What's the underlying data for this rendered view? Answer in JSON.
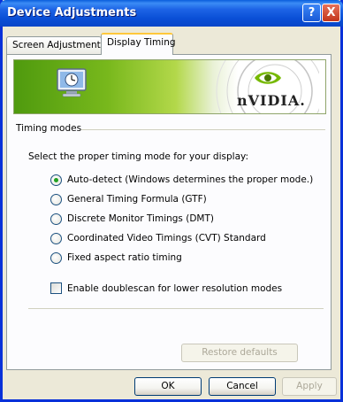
{
  "window": {
    "title": "Device Adjustments",
    "help_icon": "?",
    "close_icon": "X"
  },
  "tabs": [
    {
      "label": "Screen Adjustment",
      "active": false
    },
    {
      "label": "Display Timing",
      "active": true
    }
  ],
  "banner": {
    "logo_text": "nVIDIA.",
    "icons": [
      "monitor-clock-icon",
      "nvidia-eye-logo"
    ],
    "colors": {
      "green": "#78b81c",
      "white": "#ffffff"
    }
  },
  "timing": {
    "group_label": "Timing modes",
    "prompt": "Select the proper timing mode for your display:",
    "options": [
      {
        "label": "Auto-detect (Windows determines the proper mode.)",
        "selected": true
      },
      {
        "label": "General Timing Formula (GTF)",
        "selected": false
      },
      {
        "label": "Discrete Monitor Timings (DMT)",
        "selected": false
      },
      {
        "label": "Coordinated Video Timings (CVT) Standard",
        "selected": false
      },
      {
        "label": "Fixed aspect ratio timing",
        "selected": false
      }
    ],
    "doublescan_label": "Enable doublescan for lower resolution modes",
    "doublescan_checked": false
  },
  "buttons": {
    "restore": "Restore defaults",
    "ok": "OK",
    "cancel": "Cancel",
    "apply": "Apply"
  },
  "colors": {
    "titlebar": "#0a4fd6",
    "dialog_bg": "#ece9d8",
    "panel_bg": "#fcfcfe",
    "radio_selected": "#21a121"
  }
}
